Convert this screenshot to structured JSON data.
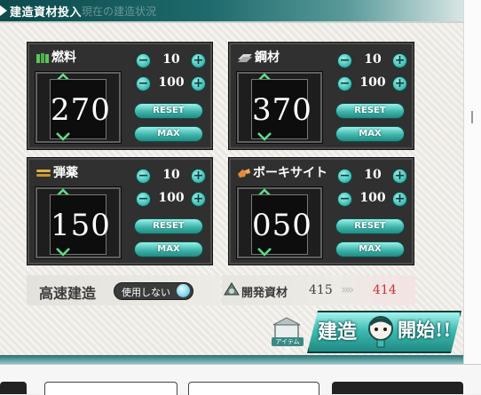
{
  "title": {
    "main": "建造資材投入",
    "ghost": "現在の建造状況"
  },
  "resources": [
    {
      "name": "燃料",
      "icon": "fuel-icon",
      "value": "270",
      "step_small": "10",
      "step_large": "100",
      "reset_label": "RESET",
      "max_label": "MAX"
    },
    {
      "name": "鋼材",
      "icon": "steel-icon",
      "value": "370",
      "step_small": "10",
      "step_large": "100",
      "reset_label": "RESET",
      "max_label": "MAX"
    },
    {
      "name": "弾薬",
      "icon": "ammo-icon",
      "value": "150",
      "step_small": "10",
      "step_large": "100",
      "reset_label": "RESET",
      "max_label": "MAX"
    },
    {
      "name": "ボーキサイト",
      "icon": "bauxite-icon",
      "value": "050",
      "step_small": "10",
      "step_large": "100",
      "reset_label": "RESET",
      "max_label": "MAX"
    }
  ],
  "speed_build": {
    "label": "高速建造",
    "toggle_text": "使用しない"
  },
  "dev_material": {
    "label": "開発資材",
    "current": "415",
    "after": "414",
    "after_color": "#cc3333"
  },
  "item_shop_label": "アイテム屋",
  "start_button": {
    "left": "建造",
    "right": "開始!!"
  },
  "colors": {
    "accent": "#3fbcb2",
    "title_bar": "#0e4a4c",
    "box": "#2f302f"
  }
}
